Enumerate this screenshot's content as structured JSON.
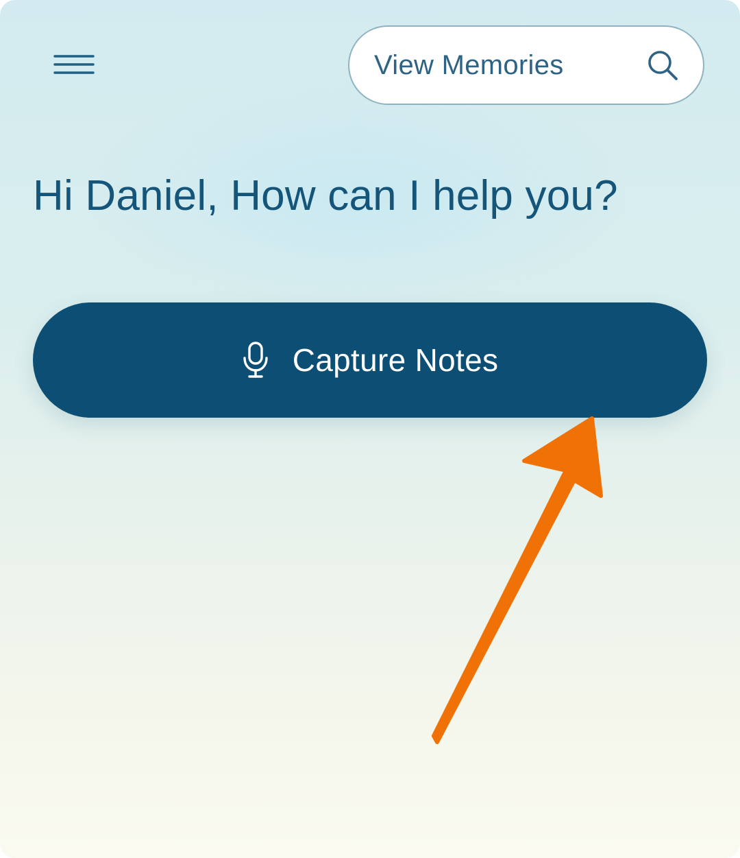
{
  "header": {
    "menu_icon": "hamburger-menu-icon",
    "search": {
      "label": "View Memories",
      "icon": "search-icon"
    }
  },
  "main": {
    "greeting": "Hi Daniel, How can I help you?",
    "capture_button": {
      "label": "Capture Notes",
      "icon": "microphone-icon"
    }
  },
  "annotation": {
    "type": "arrow",
    "color": "#f07106",
    "points_to": "capture-notes-button"
  },
  "colors": {
    "primary": "#0d4f74",
    "text": "#15557a",
    "search_text": "#2e6384",
    "pill_border": "#8fb3c1"
  }
}
